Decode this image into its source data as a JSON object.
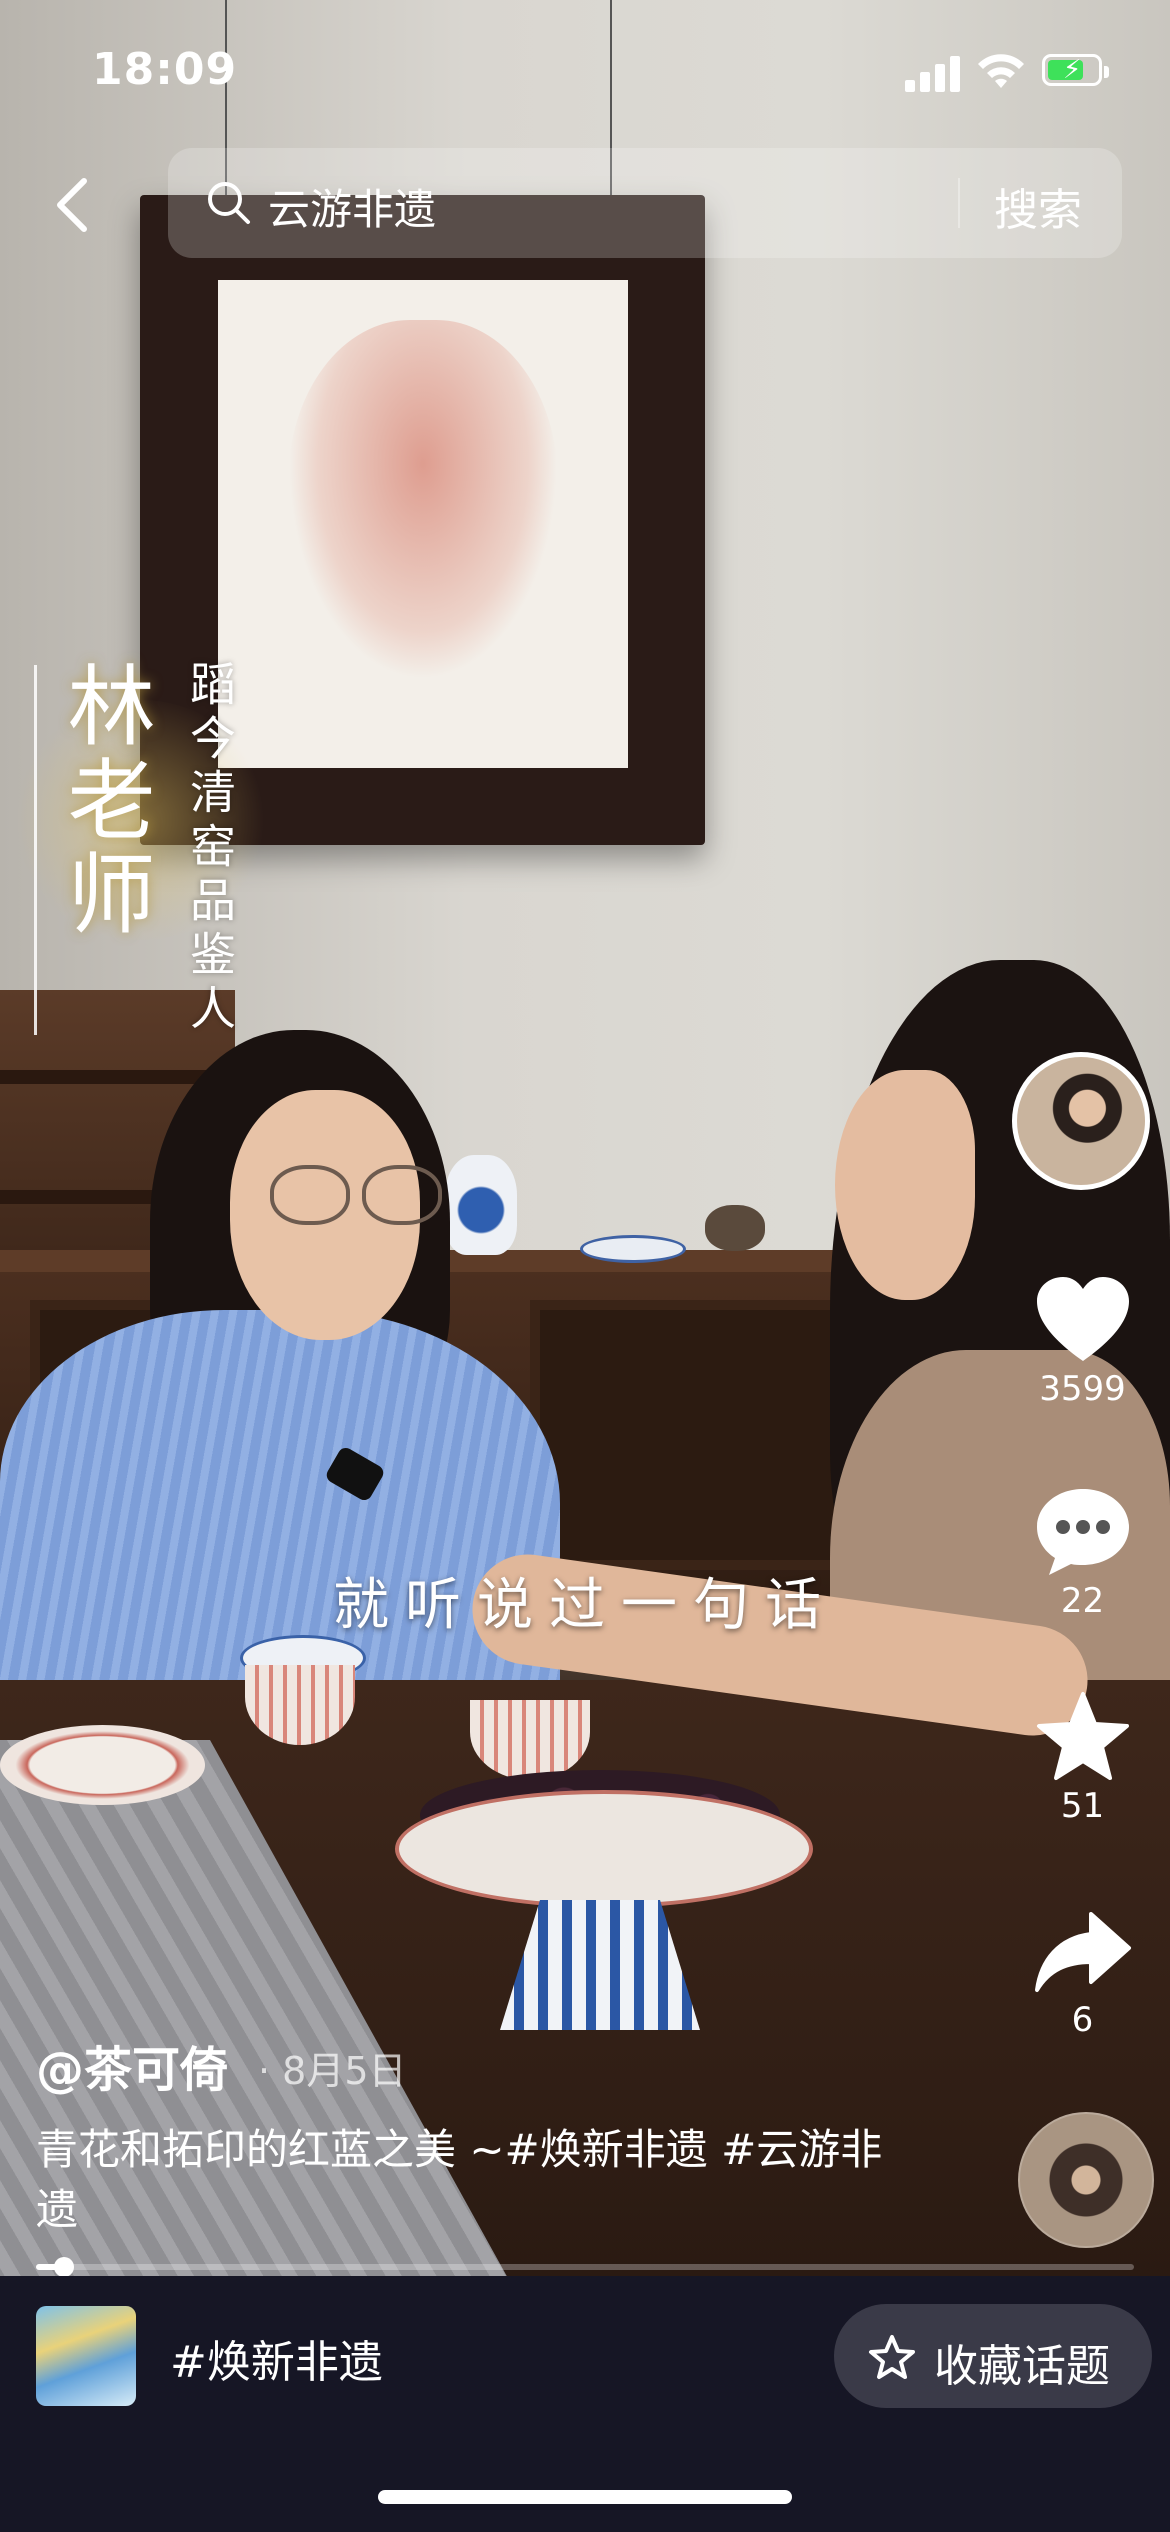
{
  "status_bar": {
    "time": "18:09",
    "battery_level": 0.75
  },
  "search": {
    "query": "云游非遗",
    "button_label": "搜索"
  },
  "video_overlay": {
    "name_vertical": "林老师",
    "title_vertical": "蹈今清窑品鉴人",
    "subtitle": "就听说过一句话"
  },
  "rail": {
    "like_count": "3599",
    "comment_count": "22",
    "favorite_count": "51",
    "share_count": "6"
  },
  "post": {
    "author": "@茶可倚",
    "date": "· 8月5日",
    "caption": "青花和拓印的红蓝之美 ~#焕新非遗  #云游非遗",
    "progress": 0.02
  },
  "bottom_bar": {
    "topic": "#焕新非遗",
    "collect_label": "收藏话题"
  },
  "colors": {
    "battery": "#3ee15a",
    "bottom_bar": "#161625"
  },
  "icons": [
    "back-icon",
    "search-icon",
    "heart-icon",
    "comment-icon",
    "star-icon",
    "share-icon",
    "signal-icon",
    "wifi-icon",
    "battery-icon"
  ]
}
